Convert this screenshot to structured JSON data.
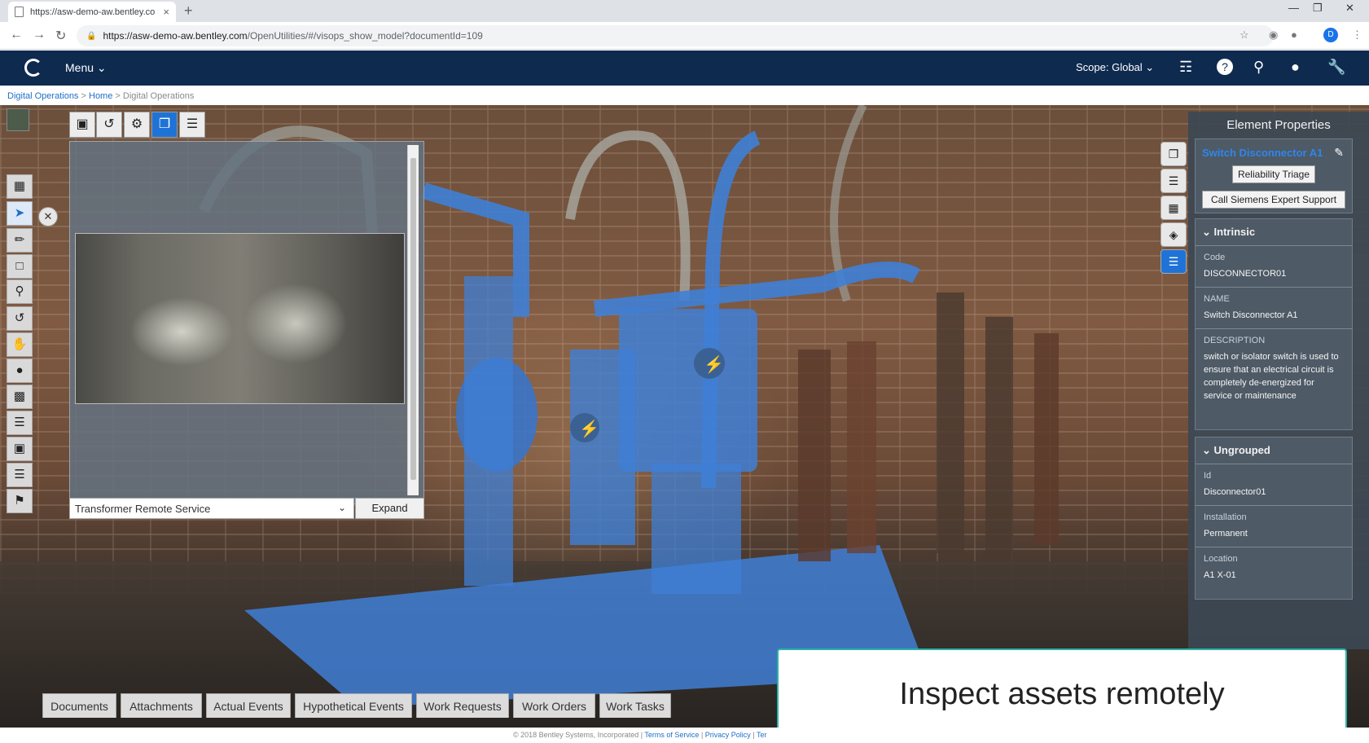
{
  "browser": {
    "tab_title": "https://asw-demo-aw.bentley.co",
    "tab_close": "×",
    "new_tab": "+",
    "url_host": "https://asw-demo-aw.bentley.com",
    "url_path": "/OpenUtilities/#/visops_show_model?documentId=109",
    "profile_initial": "D",
    "icons": [
      "back-icon",
      "forward-icon",
      "reload-icon",
      "lock-icon",
      "star-icon",
      "minimize-icon",
      "maximize-icon",
      "close-icon"
    ]
  },
  "header": {
    "menu_label": "Menu",
    "scope_label": "Scope: Global",
    "icons": [
      "basket-icon",
      "help-icon",
      "search-icon",
      "user-icon",
      "wrench-icon"
    ],
    "bg_color": "#0e2a4f"
  },
  "breadcrumb": {
    "items": [
      "Digital Operations",
      "Home",
      "Digital Operations"
    ],
    "separator": ">"
  },
  "viewer_panel": {
    "dropdown_value": "Transformer Remote Service",
    "expand_label": "Expand"
  },
  "properties": {
    "title": "Element Properties",
    "element_name": "Switch Disconnector A1",
    "buttons": [
      "Reliability Triage",
      "Call Siemens Expert Support"
    ],
    "intrinsic": {
      "heading": "Intrinsic",
      "fields": [
        {
          "label": "Code",
          "value": "DISCONNECTOR01"
        },
        {
          "label": "NAME",
          "value": "Switch Disconnector A1"
        },
        {
          "label": "DESCRIPTION",
          "value": "switch or isolator switch is used to ensure that an electrical circuit is completely de-energized for service or maintenance"
        }
      ]
    },
    "ungrouped": {
      "heading": "Ungrouped",
      "fields": [
        {
          "label": "Id",
          "value": "Disconnector01"
        },
        {
          "label": "Installation",
          "value": "Permanent"
        },
        {
          "label": "Location",
          "value": "A1 X-01"
        }
      ]
    }
  },
  "bottom_tabs": [
    "Documents",
    "Attachments",
    "Actual Events",
    "Hypothetical Events",
    "Work Requests",
    "Work Orders",
    "Work Tasks"
  ],
  "banner_text": "Inspect assets remotely",
  "footer": {
    "copyright": "© 2018 Bentley Systems, Incorporated",
    "links": [
      "Terms of Service",
      "Privacy Policy",
      "Ter"
    ]
  },
  "colors": {
    "accent": "#1f73d6",
    "highlight_blue": "#3f7fd6",
    "banner_border": "#2bb3a8"
  }
}
